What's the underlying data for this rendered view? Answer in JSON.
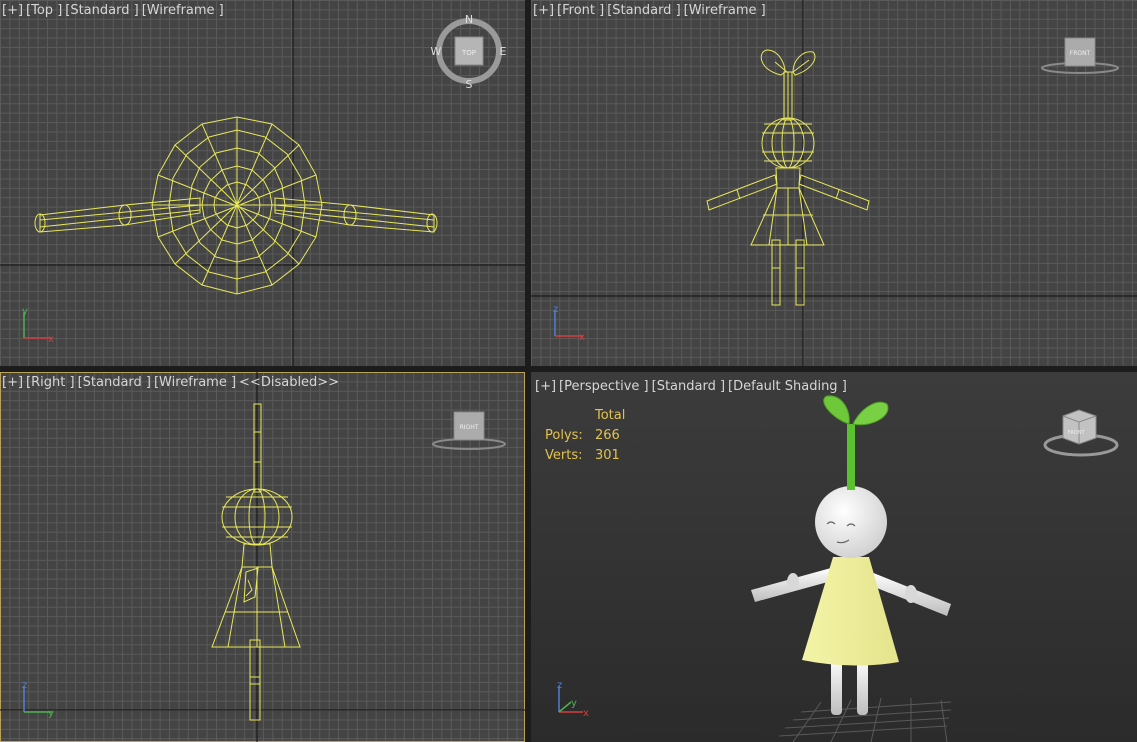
{
  "viewports": {
    "top": {
      "labels": [
        "[+]",
        "[Top ]",
        "[Standard ]",
        "[Wireframe ]"
      ],
      "cube_label": "TOP",
      "compass": {
        "n": "N",
        "s": "S",
        "e": "E",
        "w": "W"
      }
    },
    "front": {
      "labels": [
        "[+]",
        "[Front ]",
        "[Standard ]",
        "[Wireframe ]"
      ],
      "cube_label": "FRONT"
    },
    "right": {
      "labels": [
        "[+]",
        "[Right ]",
        "[Standard ]",
        "[Wireframe ]",
        "<<Disabled>>"
      ],
      "cube_label": "RIGHT"
    },
    "perspective": {
      "labels": [
        "[+]",
        "[Perspective ]",
        "[Standard ]",
        "[Default Shading ]"
      ],
      "cube_label": "FRONT"
    }
  },
  "stats": {
    "header": "Total",
    "polys_label": "Polys:",
    "polys_value": "266",
    "verts_label": "Verts:",
    "verts_value": "301"
  },
  "axes": {
    "x": "x",
    "y": "y",
    "z": "z"
  },
  "colors": {
    "wireframe": "#e8e85a",
    "viewport_bg": "#444444",
    "active_border": "#b9a35a",
    "stat_text": "#e3c24b",
    "dress": "#f2f2a0",
    "leaf": "#6ec83a",
    "skin": "#ececec"
  }
}
